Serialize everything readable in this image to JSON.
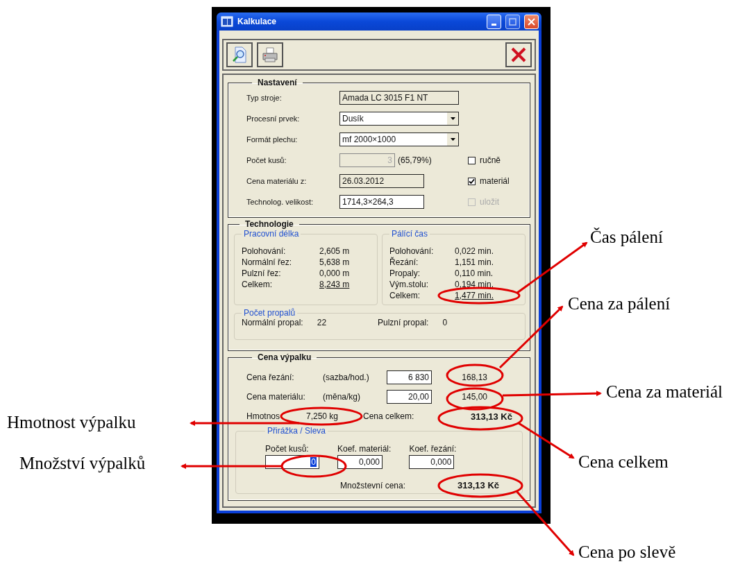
{
  "window": {
    "title": "Kalkulace"
  },
  "settings": {
    "title": "Nastavení",
    "rows": [
      {
        "label": "Typ stroje:",
        "kind": "readonly",
        "value": "Amada LC 3015 F1 NT"
      },
      {
        "label": "Procesní prvek:",
        "kind": "select",
        "value": "Dusík"
      },
      {
        "label": "Formát plechu:",
        "kind": "select",
        "value": "mf 2000×1000"
      },
      {
        "label": "Počet kusů:",
        "kind": "disabled",
        "value": "3",
        "note": "(65,79%)",
        "checkbox": {
          "label": "ručně",
          "checked": false,
          "disabled": false
        }
      },
      {
        "label": "Cena materiálu z:",
        "kind": "readonly",
        "value": "26.03.2012",
        "checkbox": {
          "label": "materiál",
          "checked": true,
          "disabled": false
        }
      },
      {
        "label": "Technolog. velikost:",
        "kind": "input",
        "value": "1714,3×264,3",
        "checkbox": {
          "label": "uložit",
          "checked": false,
          "disabled": true
        }
      }
    ]
  },
  "technology": {
    "title": "Technologie",
    "groups": [
      {
        "title": "Pracovní délka",
        "rows": [
          {
            "label": "Polohování:",
            "value": "2,605 m",
            "total": false
          },
          {
            "label": "Normální řez:",
            "value": "5,638 m",
            "total": false
          },
          {
            "label": "Pulzní řez:",
            "value": "0,000 m",
            "total": false
          },
          {
            "label": "Celkem:",
            "value": "8,243 m",
            "total": true
          }
        ]
      },
      {
        "title": "Pálící čas",
        "rows": [
          {
            "label": "Polohování:",
            "value": "0,022 min.",
            "total": false
          },
          {
            "label": "Řezání:",
            "value": "1,151 min.",
            "total": false
          },
          {
            "label": "Propaly:",
            "value": "0,110 min.",
            "total": false
          },
          {
            "label": "Vým.stolu:",
            "value": "0,194 min.",
            "total": false
          },
          {
            "label": "Celkem:",
            "value": "1,477 min.",
            "total": true
          }
        ]
      }
    ],
    "burns": {
      "title": "Počet propalů",
      "items": [
        {
          "label": "Normální propal:",
          "value": "22"
        },
        {
          "label": "Pulzní propal:",
          "value": "0"
        }
      ]
    }
  },
  "price": {
    "title": "Cena výpalku",
    "rows": [
      {
        "label": "Cena řezání:",
        "unit": "(sazba/hod.)",
        "value": "6 830",
        "result": "168,13"
      },
      {
        "label": "Cena materiálu:",
        "unit": "(měna/kg)",
        "value": "20,00",
        "result": "145,00"
      }
    ],
    "weight": {
      "label": "Hmotnos",
      "value": "7,250 kg"
    },
    "total": {
      "label": "Cena celkem:",
      "value": "313,13 Kč"
    },
    "discount": {
      "title": "Přirážka / Sleva",
      "fields": [
        {
          "label": "Počet kusů:",
          "value": "0",
          "focused": true
        },
        {
          "label": "Koef. materiál:",
          "value": "0,000",
          "focused": false
        },
        {
          "label": "Koef. řezání:",
          "value": "0,000",
          "focused": false
        }
      ],
      "total": {
        "label": "Množstevní cena:",
        "value": "313,13 Kč"
      }
    }
  },
  "callouts": [
    {
      "label": "Čas pálení"
    },
    {
      "label": "Cena za pálení"
    },
    {
      "label": "Cena za materiál"
    },
    {
      "label": "Cena celkem"
    },
    {
      "label": "Cena po slevě"
    },
    {
      "label": "Hmotnost výpalku"
    },
    {
      "label": "Množství výpalků"
    }
  ]
}
